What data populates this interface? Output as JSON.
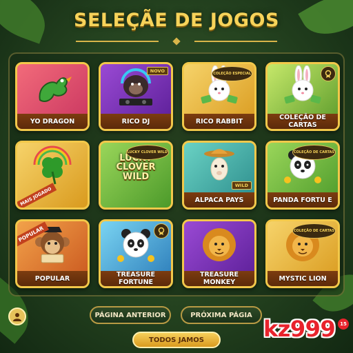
{
  "header": {
    "title": "SELEÇÃE DE JOGOS"
  },
  "games": [
    {
      "name": "YO DRAGON",
      "theme": "red",
      "icon": "dragon-icon"
    },
    {
      "name": "RICO DJ",
      "theme": "purple",
      "icon": "gorilla-dj-icon",
      "tag": "NOVO"
    },
    {
      "name": "RICO RABBIT",
      "theme": "gold",
      "icon": "rabbit-icon",
      "badge": "COLEÇÃO ESPECIAL"
    },
    {
      "name": "COLEÇÃO DE CARTAS",
      "theme": "lime",
      "icon": "rabbit-icon",
      "badge": ""
    },
    {
      "name": "",
      "theme": "gold",
      "icon": "clover-icon",
      "ribbon": "MAIS JOGADO"
    },
    {
      "name": "",
      "theme": "green",
      "icon": "clover-text-icon",
      "art_title": "LUCKY CLOVER WILD",
      "badge": "LUCKY CLOVER WILD"
    },
    {
      "name": "ALPACA PAYS",
      "theme": "teal",
      "icon": "alpaca-icon",
      "art_tag": "WILD"
    },
    {
      "name": "PANDA FORTU E",
      "theme": "green",
      "icon": "panda-icon",
      "badge": "COLEÇÃO DE CARTAS"
    },
    {
      "name": "POPULAR",
      "theme": "orange",
      "icon": "monkey-icon",
      "ribbon": "POPULAR"
    },
    {
      "name": "TREASURE FORTUNE",
      "theme": "sky",
      "icon": "panda-icon",
      "badge": ""
    },
    {
      "name": "TREASURE MONKEY",
      "theme": "purple",
      "icon": "lion-icon"
    },
    {
      "name": "MYSTIC LION",
      "theme": "gold",
      "icon": "lion-icon",
      "badge": "COLEÇÃO DE CARTAS"
    }
  ],
  "pagination": {
    "prev_label": "PÁGINA ANTERIOR",
    "next_label": "PRÓXIMA PÁGIA"
  },
  "all_games_label": "TODOS JAMOS",
  "brand": {
    "name": "kz999",
    "badge": "15"
  },
  "colors": {
    "title": "#f6d35a",
    "brand": "#e8232c",
    "card_border": "#f2c84a"
  }
}
